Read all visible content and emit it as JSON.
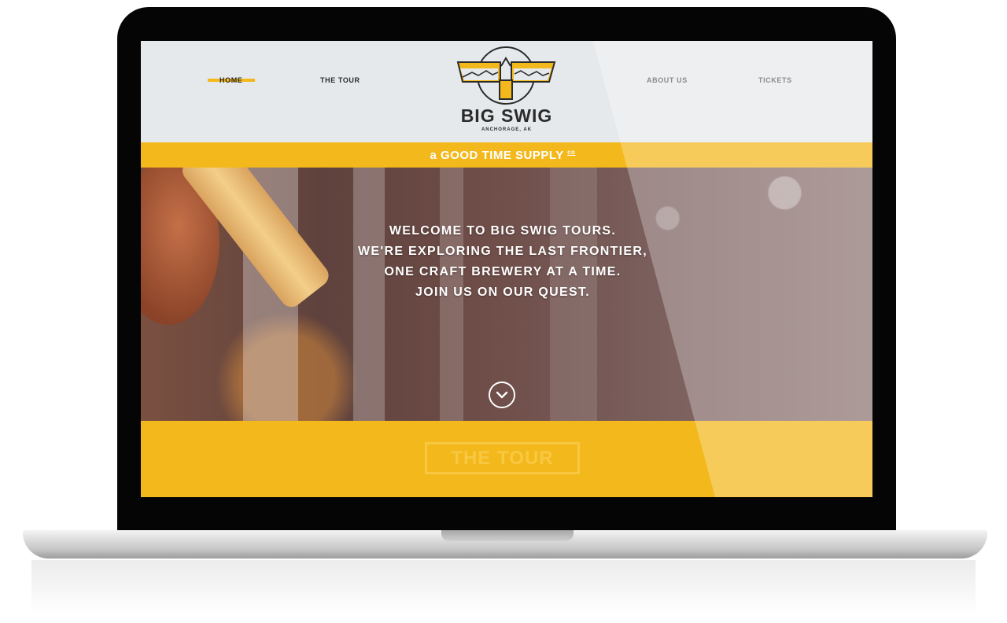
{
  "nav": {
    "items": [
      {
        "label": "HOME",
        "active": true
      },
      {
        "label": "THE TOUR",
        "active": false
      },
      {
        "label": "ABOUT US",
        "active": false
      },
      {
        "label": "TICKETS",
        "active": false
      }
    ]
  },
  "logo": {
    "title": "BIG SWIG",
    "subtitle": "ANCHORAGE, AK"
  },
  "tagline": {
    "text": "a GOOD TIME SUPPLY",
    "suffix": "co"
  },
  "hero": {
    "lines": [
      "WELCOME TO BIG SWIG TOURS.",
      "WE'RE EXPLORING THE LAST FRONTIER,",
      "ONE CRAFT BREWERY AT A TIME.",
      "JOIN US ON OUR QUEST."
    ],
    "scroll_icon": "chevron-down-icon"
  },
  "tour_section": {
    "button_label": "THE TOUR"
  },
  "colors": {
    "accent": "#f3b81b",
    "header_bg": "#e6e9ec",
    "text_dark": "#2b2b2b"
  }
}
